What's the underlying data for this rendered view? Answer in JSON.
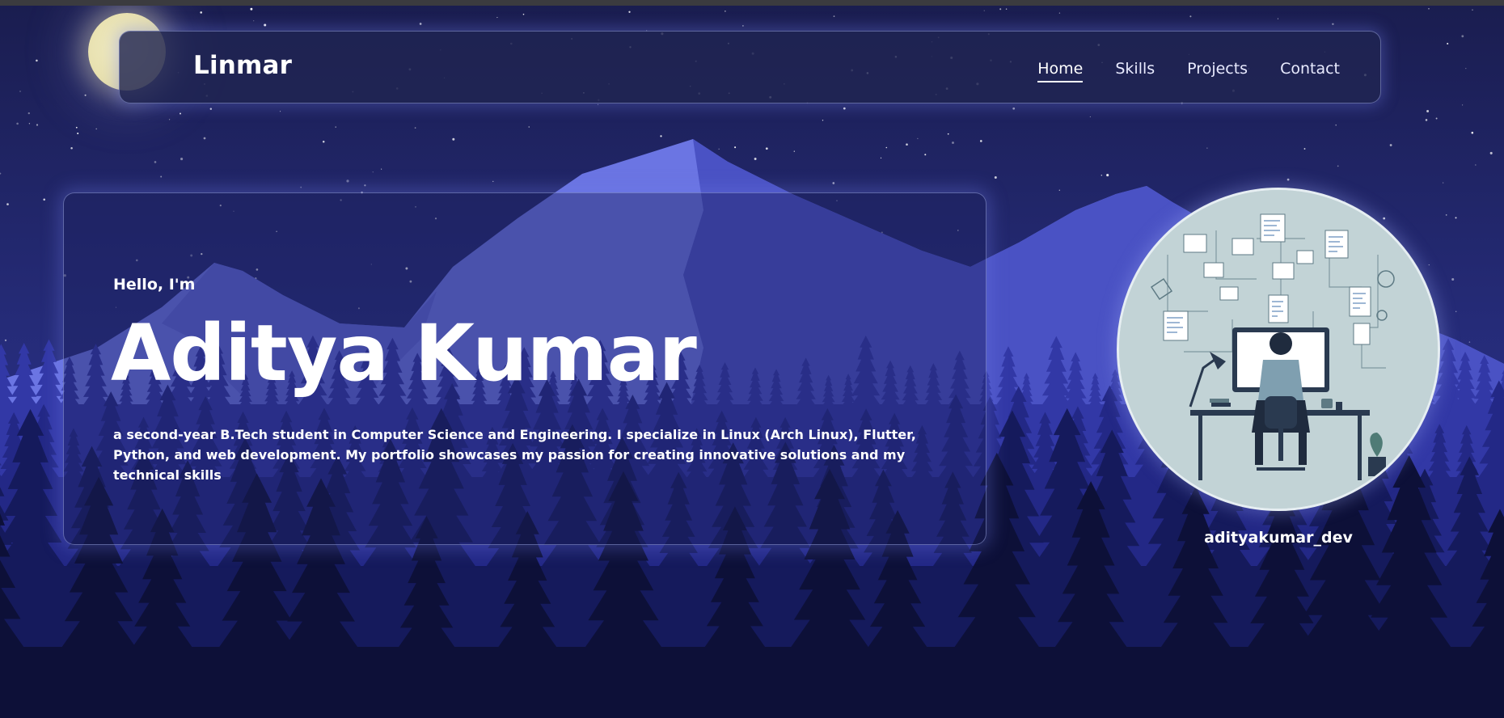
{
  "header": {
    "brand": "Linmar",
    "nav": [
      {
        "label": "Home",
        "active": true
      },
      {
        "label": "Skills",
        "active": false
      },
      {
        "label": "Projects",
        "active": false
      },
      {
        "label": "Contact",
        "active": false
      }
    ]
  },
  "hero": {
    "greeting": "Hello, I'm",
    "name": "Aditya Kumar",
    "description": "a second-year B.Tech student in Computer Science and Engineering. I specialize in Linux (Arch Linux), Flutter, Python, and web development. My portfolio showcases my passion for creating innovative solutions and my technical skills"
  },
  "profile": {
    "handle": "adityakumar_dev"
  },
  "colors": {
    "sky": "#1d2160",
    "mountain_light": "#6e79e6",
    "forest_dark": "#0d1038",
    "moon": "#efe8bd",
    "text": "#ffffff"
  }
}
